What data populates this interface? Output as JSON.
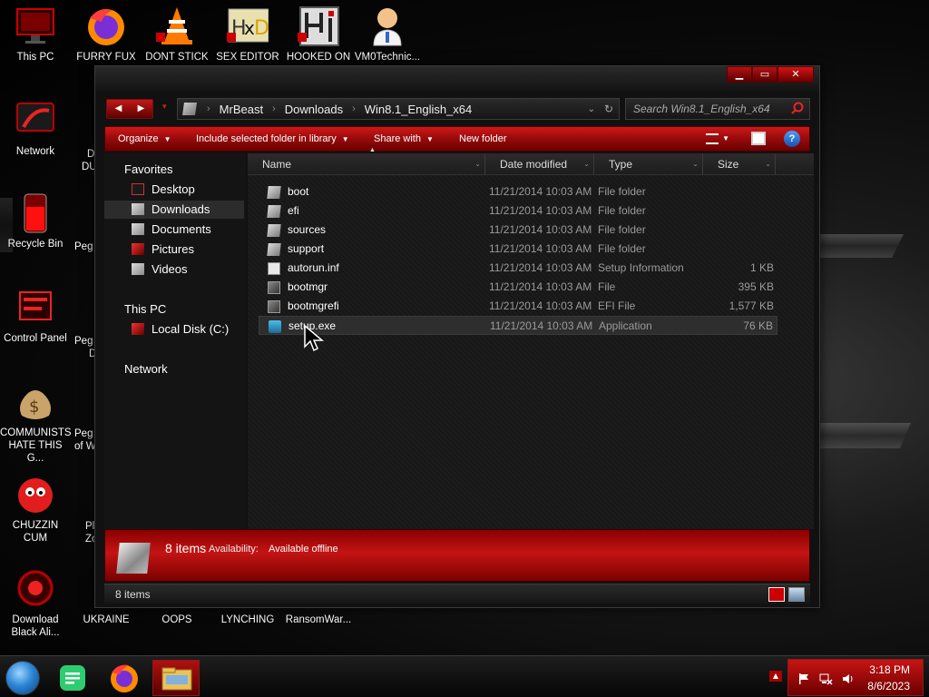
{
  "desktop": {
    "icons": [
      {
        "label": "This PC"
      },
      {
        "label": "FURRY FUX"
      },
      {
        "label": "DONT STICK"
      },
      {
        "label": "SEX EDITOR"
      },
      {
        "label": "HOOKED ON"
      },
      {
        "label": "VM0Technic..."
      },
      {
        "label": "Network"
      },
      {
        "label": "Recycle Bin"
      },
      {
        "label": "Control Panel"
      },
      {
        "label": "COMMUNISTS HATE THIS G..."
      },
      {
        "label": "CHUZZIN CUM"
      },
      {
        "label": "Download Black Ali..."
      },
      {
        "label": "UKRAINE"
      },
      {
        "label": "OOPS"
      },
      {
        "label": "LYNCHING"
      },
      {
        "label": "RansomWar..."
      }
    ],
    "partial_labels": [
      "D",
      "DU",
      "Peg",
      "Peg",
      "D",
      "Peg",
      "of W",
      "Pl",
      "Zo"
    ]
  },
  "explorer": {
    "window_buttons": {
      "minimize": "▁",
      "maximize": "▭",
      "close": "✕"
    },
    "nav": {
      "back": "◀",
      "forward": "▶",
      "recent": "▾"
    },
    "breadcrumb": [
      "MrBeast",
      "Downloads",
      "Win8.1_English_x64"
    ],
    "breadcrumb_sep": "›",
    "address_dropdown": "⌄",
    "refresh": "↻",
    "search": {
      "placeholder": "Search Win8.1_English_x64",
      "icon": "🔍"
    },
    "toolbar": {
      "organize": "Organize",
      "include_library": "Include selected folder in library",
      "share_with": "Share with",
      "new_folder": "New folder",
      "caret": "▼",
      "help": "?"
    },
    "navpane": {
      "favorites": "Favorites",
      "desktop": "Desktop",
      "downloads": "Downloads",
      "documents": "Documents",
      "pictures": "Pictures",
      "videos": "Videos",
      "this_pc": "This PC",
      "local_disk": "Local Disk (C:)",
      "network": "Network"
    },
    "columns": {
      "name": "Name",
      "date_modified": "Date modified",
      "type": "Type",
      "size": "Size",
      "sort": "▲",
      "hcaret": "⌄"
    },
    "files": [
      {
        "name": "boot",
        "date": "11/21/2014 10:03 AM",
        "type": "File folder",
        "size": "",
        "icon": "folder-icon"
      },
      {
        "name": "efi",
        "date": "11/21/2014 10:03 AM",
        "type": "File folder",
        "size": "",
        "icon": "folder-icon"
      },
      {
        "name": "sources",
        "date": "11/21/2014 10:03 AM",
        "type": "File folder",
        "size": "",
        "icon": "folder-icon"
      },
      {
        "name": "support",
        "date": "11/21/2014 10:03 AM",
        "type": "File folder",
        "size": "",
        "icon": "folder-icon"
      },
      {
        "name": "autorun.inf",
        "date": "11/21/2014 10:03 AM",
        "type": "Setup Information",
        "size": "1 KB",
        "icon": "setup-info-icon"
      },
      {
        "name": "bootmgr",
        "date": "11/21/2014 10:03 AM",
        "type": "File",
        "size": "395 KB",
        "icon": "system-file-icon"
      },
      {
        "name": "bootmgrefi",
        "date": "11/21/2014 10:03 AM",
        "type": "EFI File",
        "size": "1,577 KB",
        "icon": "system-file-icon"
      },
      {
        "name": "setup.exe",
        "date": "11/21/2014 10:03 AM",
        "type": "Application",
        "size": "76 KB",
        "icon": "application-icon"
      }
    ],
    "details": {
      "count": "8 items",
      "availability_label": "Availability:",
      "availability_value": "Available offline"
    },
    "status": {
      "items": "8 items"
    }
  },
  "taskbar": {
    "time": "3:18 PM",
    "date": "8/6/2023",
    "overflow": "▲"
  }
}
